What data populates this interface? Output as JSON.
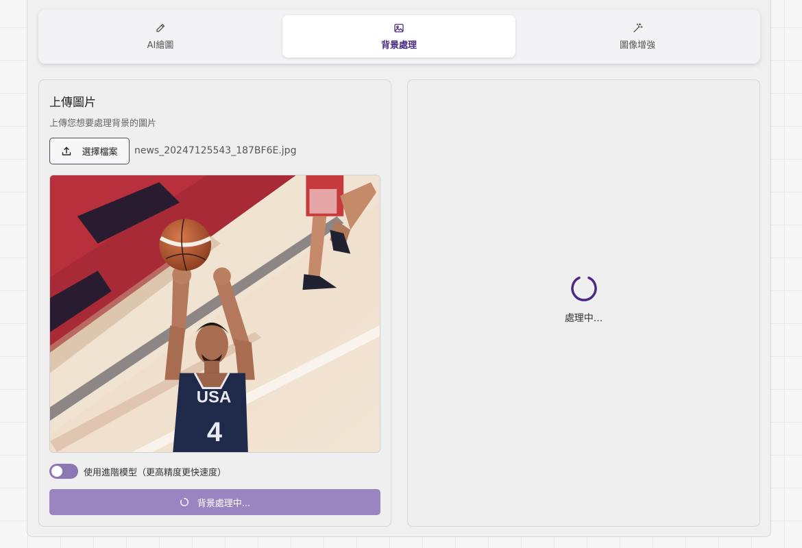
{
  "tabs": {
    "ai_label": "AI繪圖",
    "bg_label": "背景處理",
    "enhance_label": "圖像增強",
    "active": "背景處理"
  },
  "upload": {
    "title": "上傳圖片",
    "subtitle": "上傳您想要處理背景的圖片",
    "choose_file_label": "選擇檔案",
    "file_name": "news_20247125543_187BF6E.jpg"
  },
  "preview_image": {
    "jersey_text": "USA",
    "jersey_number": "4"
  },
  "options": {
    "advanced_model_label": "使用進階模型（更高精度更快速度）",
    "advanced_model_enabled": false
  },
  "process_button": {
    "label": "背景處理中..."
  },
  "result": {
    "status_text": "處理中..."
  },
  "colors": {
    "accent": "#4a2a86",
    "button_bg": "#9a85c0",
    "toggle_bg": "#8b77b3"
  },
  "icons": {
    "ai_tab": "pencil-icon",
    "bg_tab": "image-icon",
    "enhance_tab": "magic-wand-icon",
    "upload": "upload-icon",
    "loading": "spinner-icon"
  }
}
